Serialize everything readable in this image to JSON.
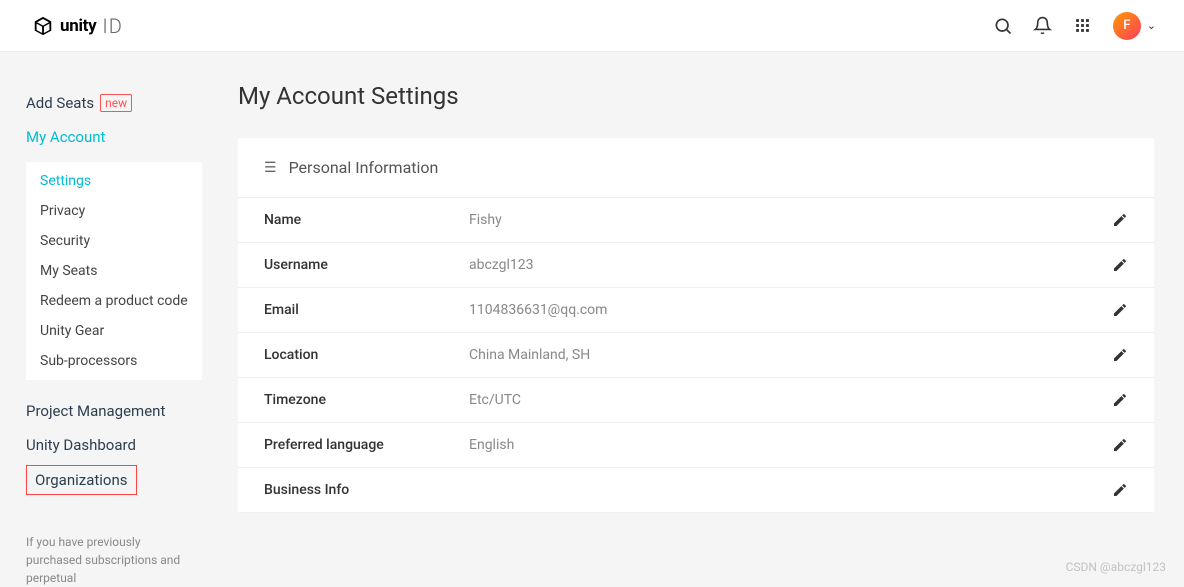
{
  "header": {
    "logo_text": "unity",
    "id_text": "ID",
    "avatar_letter": "F"
  },
  "sidebar": {
    "add_seats": "Add Seats",
    "badge_new": "new",
    "my_account": "My Account",
    "sub": {
      "settings": "Settings",
      "privacy": "Privacy",
      "security": "Security",
      "my_seats": "My Seats",
      "redeem": "Redeem a product code",
      "unity_gear": "Unity Gear",
      "sub_processors": "Sub-processors"
    },
    "project_management": "Project Management",
    "unity_dashboard": "Unity Dashboard",
    "organizations": "Organizations",
    "note": "If you have previously purchased subscriptions and perpetual"
  },
  "main": {
    "title": "My Account Settings",
    "section_title": "Personal Information",
    "rows": {
      "name": {
        "label": "Name",
        "value": "Fishy"
      },
      "username": {
        "label": "Username",
        "value": "abczgl123"
      },
      "email": {
        "label": "Email",
        "value": "1104836631@qq.com"
      },
      "location": {
        "label": "Location",
        "value": "China Mainland, SH"
      },
      "timezone": {
        "label": "Timezone",
        "value": "Etc/UTC"
      },
      "language": {
        "label": "Preferred language",
        "value": "English"
      },
      "business": {
        "label": "Business Info",
        "value": ""
      }
    }
  },
  "watermark": "CSDN @abczgl123"
}
